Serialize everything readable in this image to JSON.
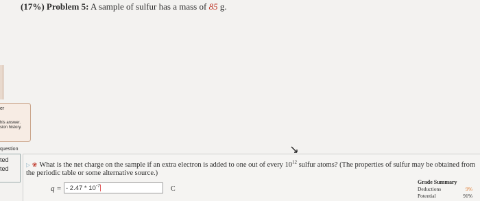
{
  "problem": {
    "percent": "(17%)",
    "label": "Problem 5:",
    "statement": "A sample of sulfur has a mass of",
    "mass": "85",
    "unit": "g."
  },
  "side_panel": {
    "heading": "er",
    "line1": "his answer.",
    "line2": "sion history."
  },
  "left_fragments": {
    "question": "question",
    "line_a": "ted",
    "line_b": "ted"
  },
  "question": {
    "text_part1": "What is the net charge on the sample if an extra electron is added to one out of every 10",
    "exponent": "12",
    "text_part2": " sulfur atoms? (The properties of sulfur may be obtained from the periodic table or some alternative source.)",
    "variable": "q =",
    "answer_value": "- 2.47 * 10",
    "answer_exponent": "-7",
    "unit": "C"
  },
  "grade_summary": {
    "title": "Grade Summary",
    "deductions_label": "Deductions",
    "deductions_value": "9%",
    "potential_label": "Potential",
    "potential_value": "91%"
  },
  "colors": {
    "mass_value": "#c0392b",
    "deductions": "#e07a2f",
    "panel_border": "#c9a48a"
  }
}
